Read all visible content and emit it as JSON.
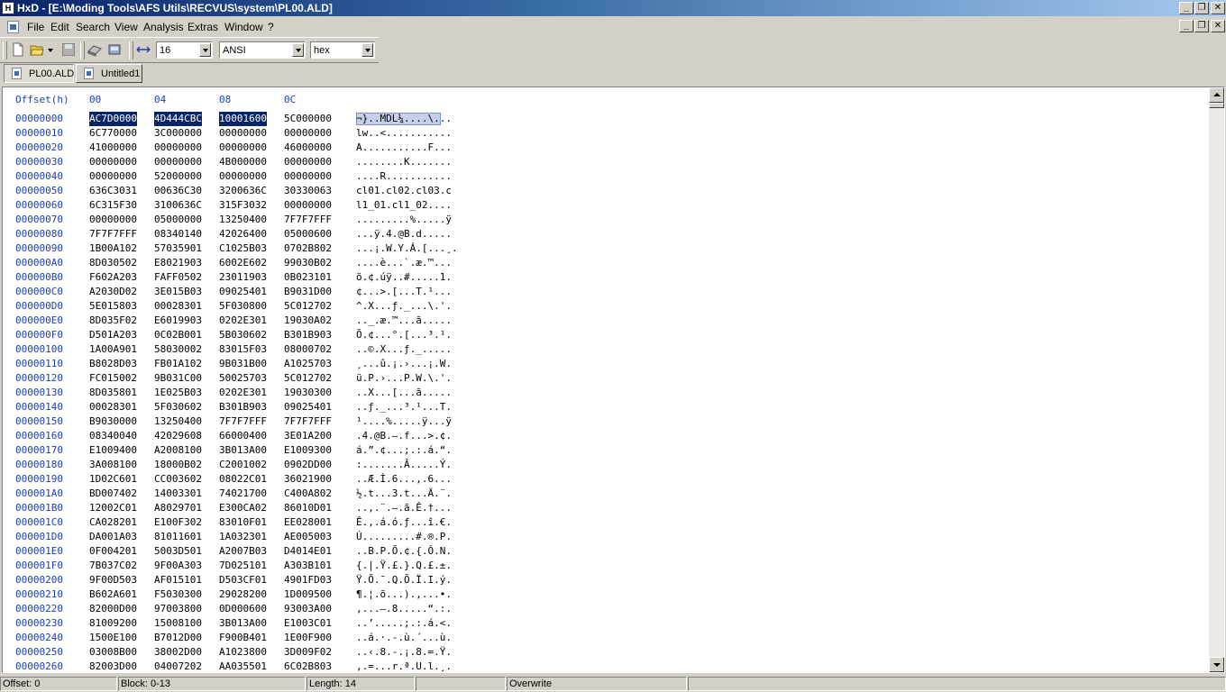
{
  "window": {
    "title": "HxD - [E:\\Moding Tools\\AFS Utils\\RECVUS\\system\\PL00.ALD]"
  },
  "menu": [
    "File",
    "Edit",
    "Search",
    "View",
    "Analysis",
    "Extras",
    "Window",
    "?"
  ],
  "toolbar": {
    "bytes_per_row": "16",
    "charset": "ANSI",
    "display_mode": "hex"
  },
  "tabs": [
    {
      "label": "PL00.ALD",
      "active": true
    },
    {
      "label": "Untitled1",
      "active": false
    }
  ],
  "editor": {
    "offset_header": "Offset(h)",
    "column_headers": [
      "00",
      "04",
      "08",
      "0C"
    ],
    "selection": {
      "start": 0,
      "end": 13
    },
    "rows": [
      {
        "offset": "00000000",
        "hex": [
          "AC7D0000",
          "4D444CBC",
          "10001600",
          "5C000000"
        ],
        "ascii": "¬}..MDL¼....\\..."
      },
      {
        "offset": "00000010",
        "hex": [
          "6C770000",
          "3C000000",
          "00000000",
          "00000000"
        ],
        "ascii": "lw..<..........."
      },
      {
        "offset": "00000020",
        "hex": [
          "41000000",
          "00000000",
          "00000000",
          "46000000"
        ],
        "ascii": "A...........F..."
      },
      {
        "offset": "00000030",
        "hex": [
          "00000000",
          "00000000",
          "4B000000",
          "00000000"
        ],
        "ascii": "........K......."
      },
      {
        "offset": "00000040",
        "hex": [
          "00000000",
          "52000000",
          "00000000",
          "00000000"
        ],
        "ascii": "....R..........."
      },
      {
        "offset": "00000050",
        "hex": [
          "636C3031",
          "00636C30",
          "3200636C",
          "30330063"
        ],
        "ascii": "cl01.cl02.cl03.c"
      },
      {
        "offset": "00000060",
        "hex": [
          "6C315F30",
          "3100636C",
          "315F3032",
          "00000000"
        ],
        "ascii": "l1_01.cl1_02...."
      },
      {
        "offset": "00000070",
        "hex": [
          "00000000",
          "05000000",
          "13250400",
          "7F7F7FFF"
        ],
        "ascii": ".........%.....ÿ"
      },
      {
        "offset": "00000080",
        "hex": [
          "7F7F7FFF",
          "08340140",
          "42026400",
          "05000600"
        ],
        "ascii": "...ÿ.4.@B.d....."
      },
      {
        "offset": "00000090",
        "hex": [
          "1B00A102",
          "57035901",
          "C1025B03",
          "0702B802"
        ],
        "ascii": "...¡.W.Y.Á.[...¸."
      },
      {
        "offset": "000000A0",
        "hex": [
          "8D030502",
          "E8021903",
          "6002E602",
          "99030B02"
        ],
        "ascii": "....è...`.æ.™..."
      },
      {
        "offset": "000000B0",
        "hex": [
          "F602A203",
          "FAFF0502",
          "23011903",
          "0B023101"
        ],
        "ascii": "ö.¢.úÿ..#.....1."
      },
      {
        "offset": "000000C0",
        "hex": [
          "A2030D02",
          "3E015B03",
          "09025401",
          "B9031D00"
        ],
        "ascii": "¢...>.[...T.¹..."
      },
      {
        "offset": "000000D0",
        "hex": [
          "5E015803",
          "00028301",
          "5F030800",
          "5C012702"
        ],
        "ascii": "^.X...ƒ._...\\.'."
      },
      {
        "offset": "000000E0",
        "hex": [
          "8D035F02",
          "E6019903",
          "0202E301",
          "19030A02"
        ],
        "ascii": ".._.æ.™...ã....."
      },
      {
        "offset": "000000F0",
        "hex": [
          "D501A203",
          "0C02B001",
          "5B030602",
          "B301B903"
        ],
        "ascii": "Õ.¢...°.[...³.¹."
      },
      {
        "offset": "00000100",
        "hex": [
          "1A00A901",
          "58030002",
          "83015F03",
          "08000702"
        ],
        "ascii": "..©.X...ƒ._....."
      },
      {
        "offset": "00000110",
        "hex": [
          "B8028D03",
          "FB01A102",
          "9B031B00",
          "A1025703"
        ],
        "ascii": "¸...û.¡.›...¡.W."
      },
      {
        "offset": "00000120",
        "hex": [
          "FC015002",
          "9B031C00",
          "50025703",
          "5C012702"
        ],
        "ascii": "ü.P.›...P.W.\\.'."
      },
      {
        "offset": "00000130",
        "hex": [
          "8D035801",
          "1E025B03",
          "0202E301",
          "19030300"
        ],
        "ascii": "..X...[...ã....."
      },
      {
        "offset": "00000140",
        "hex": [
          "00028301",
          "5F030602",
          "B301B903",
          "09025401"
        ],
        "ascii": "..ƒ._...³.¹...T."
      },
      {
        "offset": "00000150",
        "hex": [
          "B9030000",
          "13250400",
          "7F7F7FFF",
          "7F7F7FFF"
        ],
        "ascii": "¹....%.....ÿ...ÿ"
      },
      {
        "offset": "00000160",
        "hex": [
          "08340040",
          "42029608",
          "66000400",
          "3E01A200"
        ],
        "ascii": ".4.@B.–.f...>.¢."
      },
      {
        "offset": "00000170",
        "hex": [
          "E1009400",
          "A2008100",
          "3B013A00",
          "E1009300"
        ],
        "ascii": "á.”.¢...;.:.á.“."
      },
      {
        "offset": "00000180",
        "hex": [
          "3A008100",
          "18000B02",
          "C2001002",
          "0902DD00"
        ],
        "ascii": ":.......Â.....Ý."
      },
      {
        "offset": "00000190",
        "hex": [
          "1D02C601",
          "CC003602",
          "08022C01",
          "36021900"
        ],
        "ascii": "..Æ.Ì.6...,.6..."
      },
      {
        "offset": "000001A0",
        "hex": [
          "BD007402",
          "14003301",
          "74021700",
          "C400A802"
        ],
        "ascii": "½.t...3.t...Ä.¨."
      },
      {
        "offset": "000001B0",
        "hex": [
          "12002C01",
          "A8029701",
          "E300CA02",
          "86010D01"
        ],
        "ascii": "..,.¨.—.ã.Ê.†..."
      },
      {
        "offset": "000001C0",
        "hex": [
          "CA028201",
          "E100F302",
          "83010F01",
          "EE028001"
        ],
        "ascii": "Ê.‚.á.ó.ƒ...î.€."
      },
      {
        "offset": "000001D0",
        "hex": [
          "DA001A03",
          "81011601",
          "1A032301",
          "AE005003"
        ],
        "ascii": "Ú.........#.®.P."
      },
      {
        "offset": "000001E0",
        "hex": [
          "0F004201",
          "5003D501",
          "A2007B03",
          "D4014E01"
        ],
        "ascii": "..B.P.Õ.¢.{.Ô.N."
      },
      {
        "offset": "000001F0",
        "hex": [
          "7B037C02",
          "9F00A303",
          "7D025101",
          "A303B101"
        ],
        "ascii": "{.|.Ÿ.£.}.Q.£.±."
      },
      {
        "offset": "00000200",
        "hex": [
          "9F00D503",
          "AF015101",
          "D503CF01",
          "4901FD03"
        ],
        "ascii": "Ÿ.Õ.¯.Q.Õ.Ï.I.ý."
      },
      {
        "offset": "00000210",
        "hex": [
          "B602A601",
          "F5030300",
          "29028200",
          "1D009500"
        ],
        "ascii": "¶.¦.õ...).‚...•."
      },
      {
        "offset": "00000220",
        "hex": [
          "82000D00",
          "97003800",
          "0D000600",
          "93003A00"
        ],
        "ascii": "‚...—.8.....“.:."
      },
      {
        "offset": "00000230",
        "hex": [
          "81009200",
          "15008100",
          "3B013A00",
          "E1003C01"
        ],
        "ascii": "..’.....;.:.á.<."
      },
      {
        "offset": "00000240",
        "hex": [
          "1500E100",
          "B7012D00",
          "F900B401",
          "1E00F900"
        ],
        "ascii": "..á.·.-.ù.´...ù."
      },
      {
        "offset": "00000250",
        "hex": [
          "03008B00",
          "38002D00",
          "A1023800",
          "3D009F02"
        ],
        "ascii": "..‹.8.-.¡.8.=.Ÿ."
      },
      {
        "offset": "00000260",
        "hex": [
          "82003D00",
          "04007202",
          "AA035501",
          "6C02B803"
        ],
        "ascii": "‚.=...r.ª.U.l.¸."
      }
    ]
  },
  "status": {
    "offset": "Offset: 0",
    "block": "Block: 0-13",
    "length": "Length: 14",
    "mode": "Overwrite"
  }
}
